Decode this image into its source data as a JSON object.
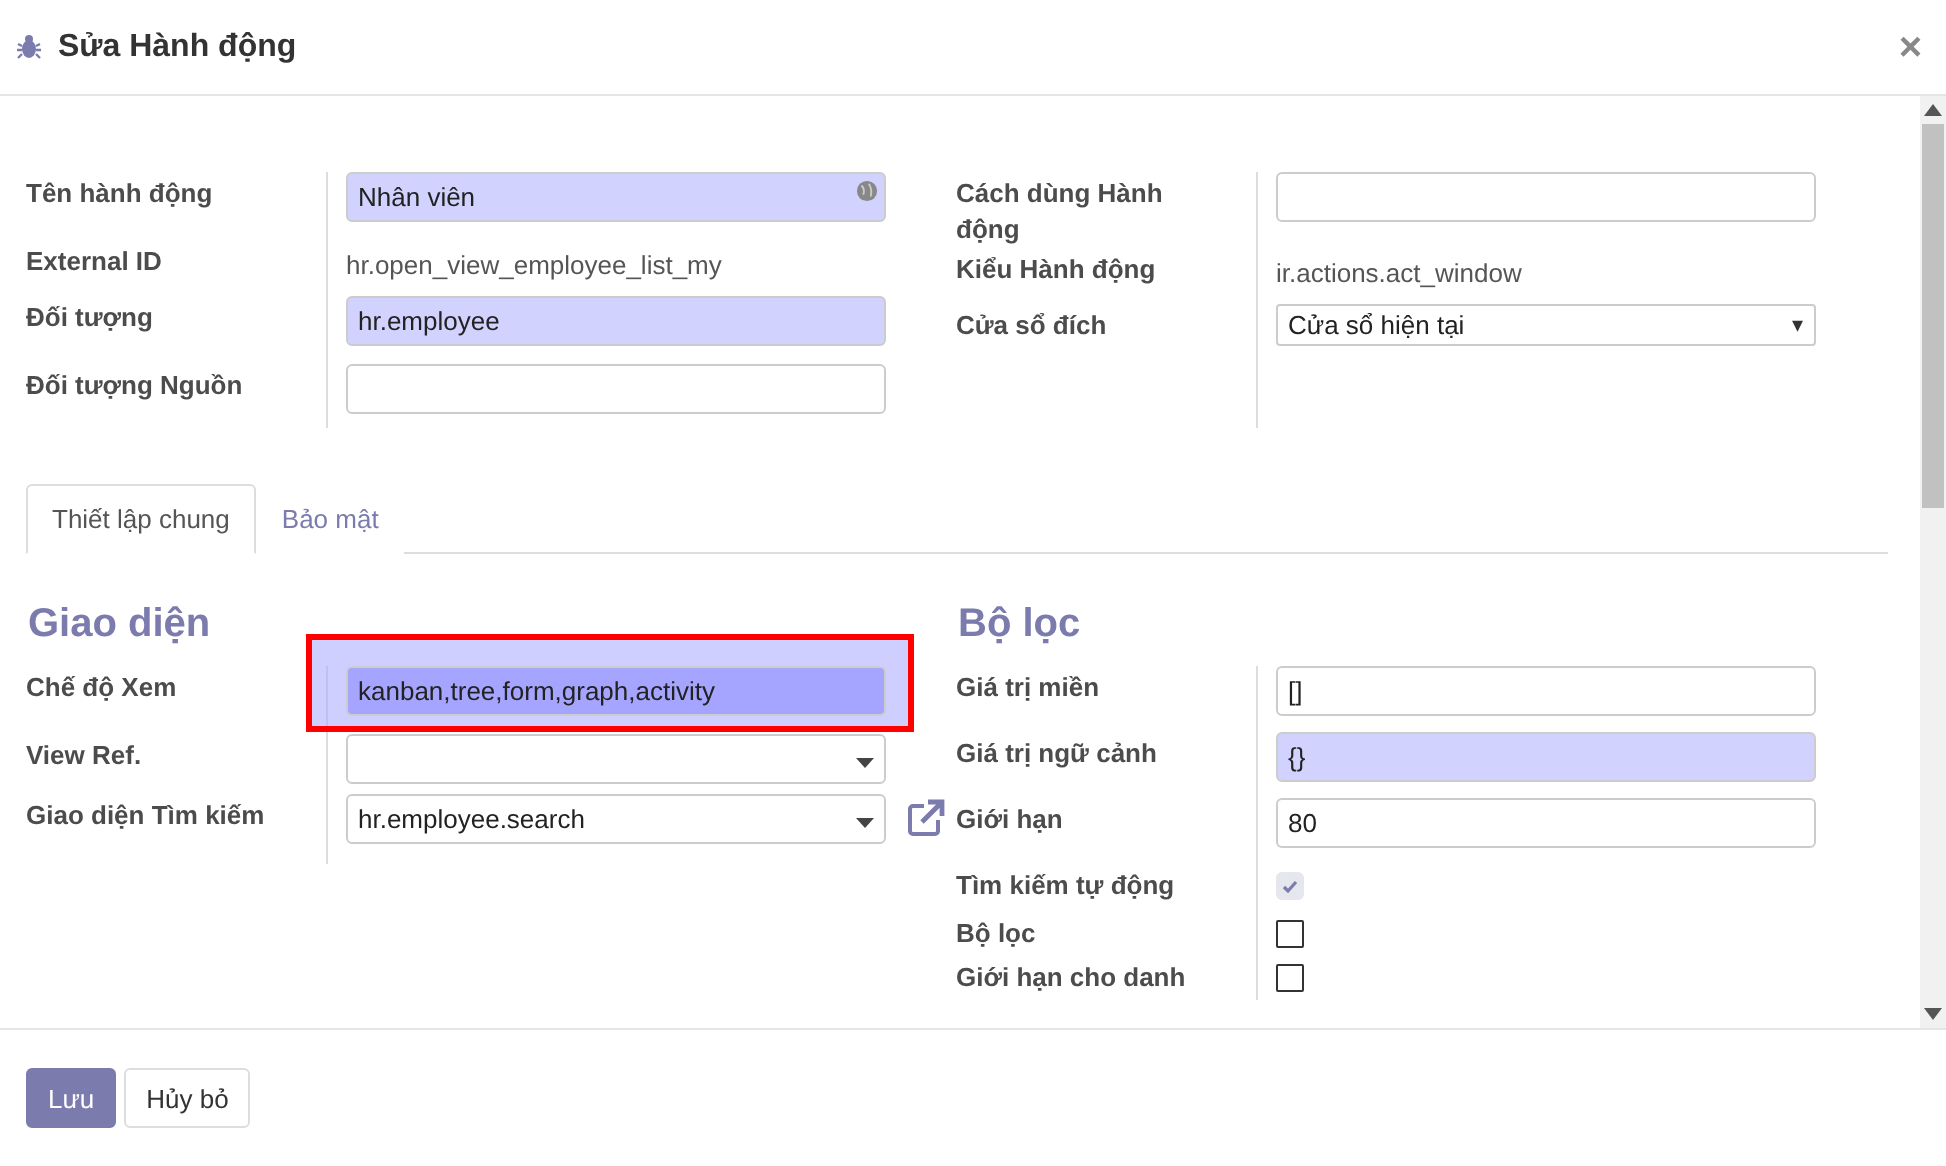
{
  "dialog": {
    "title": "Sửa Hành động",
    "close": "×"
  },
  "top_left": [
    {
      "label": "Tên hành động",
      "kind": "input",
      "value": "Nhân viên",
      "required": true,
      "translatable": true
    },
    {
      "label": "External ID",
      "kind": "text",
      "value": "hr.open_view_employee_list_my"
    },
    {
      "label": "Đối tượng",
      "kind": "input",
      "value": "hr.employee",
      "required": true
    },
    {
      "label": "Đối tượng Nguồn",
      "kind": "input"
    }
  ],
  "top_right": [
    {
      "label": "Cách dùng Hành động",
      "kind": "input"
    },
    {
      "label": "Kiểu Hành động",
      "kind": "text",
      "value": "ir.actions.act_window"
    },
    {
      "label": "Cửa sổ đích",
      "kind": "select",
      "value": "Cửa sổ hiện tại",
      "caret": "▾"
    }
  ],
  "tabs": [
    {
      "label": "Thiết lập chung",
      "selected": true
    },
    {
      "label": "Bảo mật",
      "selected": false
    }
  ],
  "view_section": {
    "title": "Giao diện",
    "fields": [
      {
        "label": "Chế độ Xem",
        "kind": "input",
        "value": "kanban,tree,form,graph,activity",
        "required": true,
        "focused": true
      },
      {
        "label": "View Ref.",
        "kind": "dropdown"
      },
      {
        "label": "Giao diện Tìm kiếm",
        "kind": "dropdown",
        "value": "hr.employee.search",
        "external_link": true
      }
    ]
  },
  "filter_section": {
    "title": "Bộ lọc",
    "fields": [
      {
        "label": "Giá trị miền",
        "kind": "input",
        "value": "[]"
      },
      {
        "label": "Giá trị ngữ cảnh",
        "kind": "input",
        "value": "{}",
        "required": true
      },
      {
        "label": "Giới hạn",
        "kind": "input",
        "value": "80"
      },
      {
        "label": "Tìm kiếm tự động",
        "kind": "checkbox",
        "checked": true,
        "disabled": true
      },
      {
        "label": "Bộ lọc",
        "kind": "checkbox",
        "checked": false,
        "disabled": false
      },
      {
        "label": "Giới hạn cho danh",
        "kind": "checkbox",
        "checked": false,
        "disabled": false
      }
    ]
  },
  "buttons": [
    {
      "label": "Lưu",
      "primary": true
    },
    {
      "label": "Hủy bỏ",
      "primary": false
    }
  ]
}
